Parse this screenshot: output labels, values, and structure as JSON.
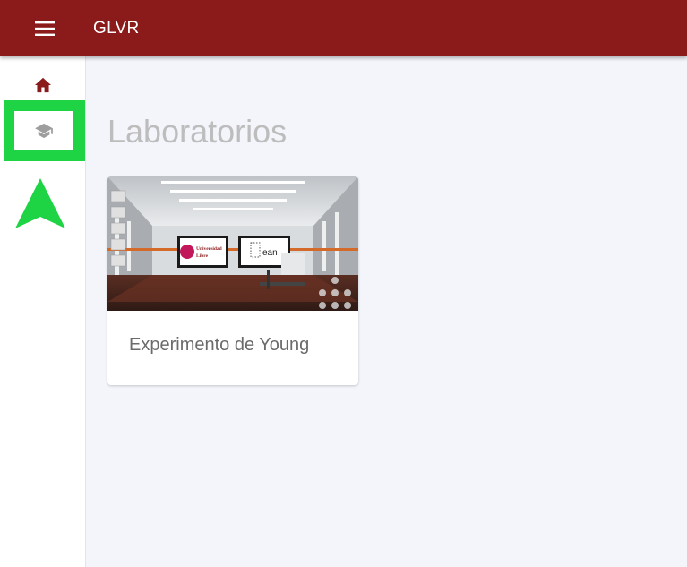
{
  "app": {
    "title": "GLVR"
  },
  "sidebar": {
    "items": [
      {
        "name": "home",
        "icon": "home-icon"
      },
      {
        "name": "laboratorios",
        "icon": "school-icon"
      }
    ]
  },
  "main": {
    "title": "Laboratorios",
    "cards": [
      {
        "title": "Experimento de Young",
        "image": {
          "logo_left_line1": "Universidad",
          "logo_left_line2": "Libre",
          "logo_right": "ean"
        }
      }
    ]
  },
  "colors": {
    "header": "#8b1a1a",
    "accent_icon": "#8b1a1a",
    "highlight": "#1ed445",
    "background": "#f4f5fb"
  }
}
